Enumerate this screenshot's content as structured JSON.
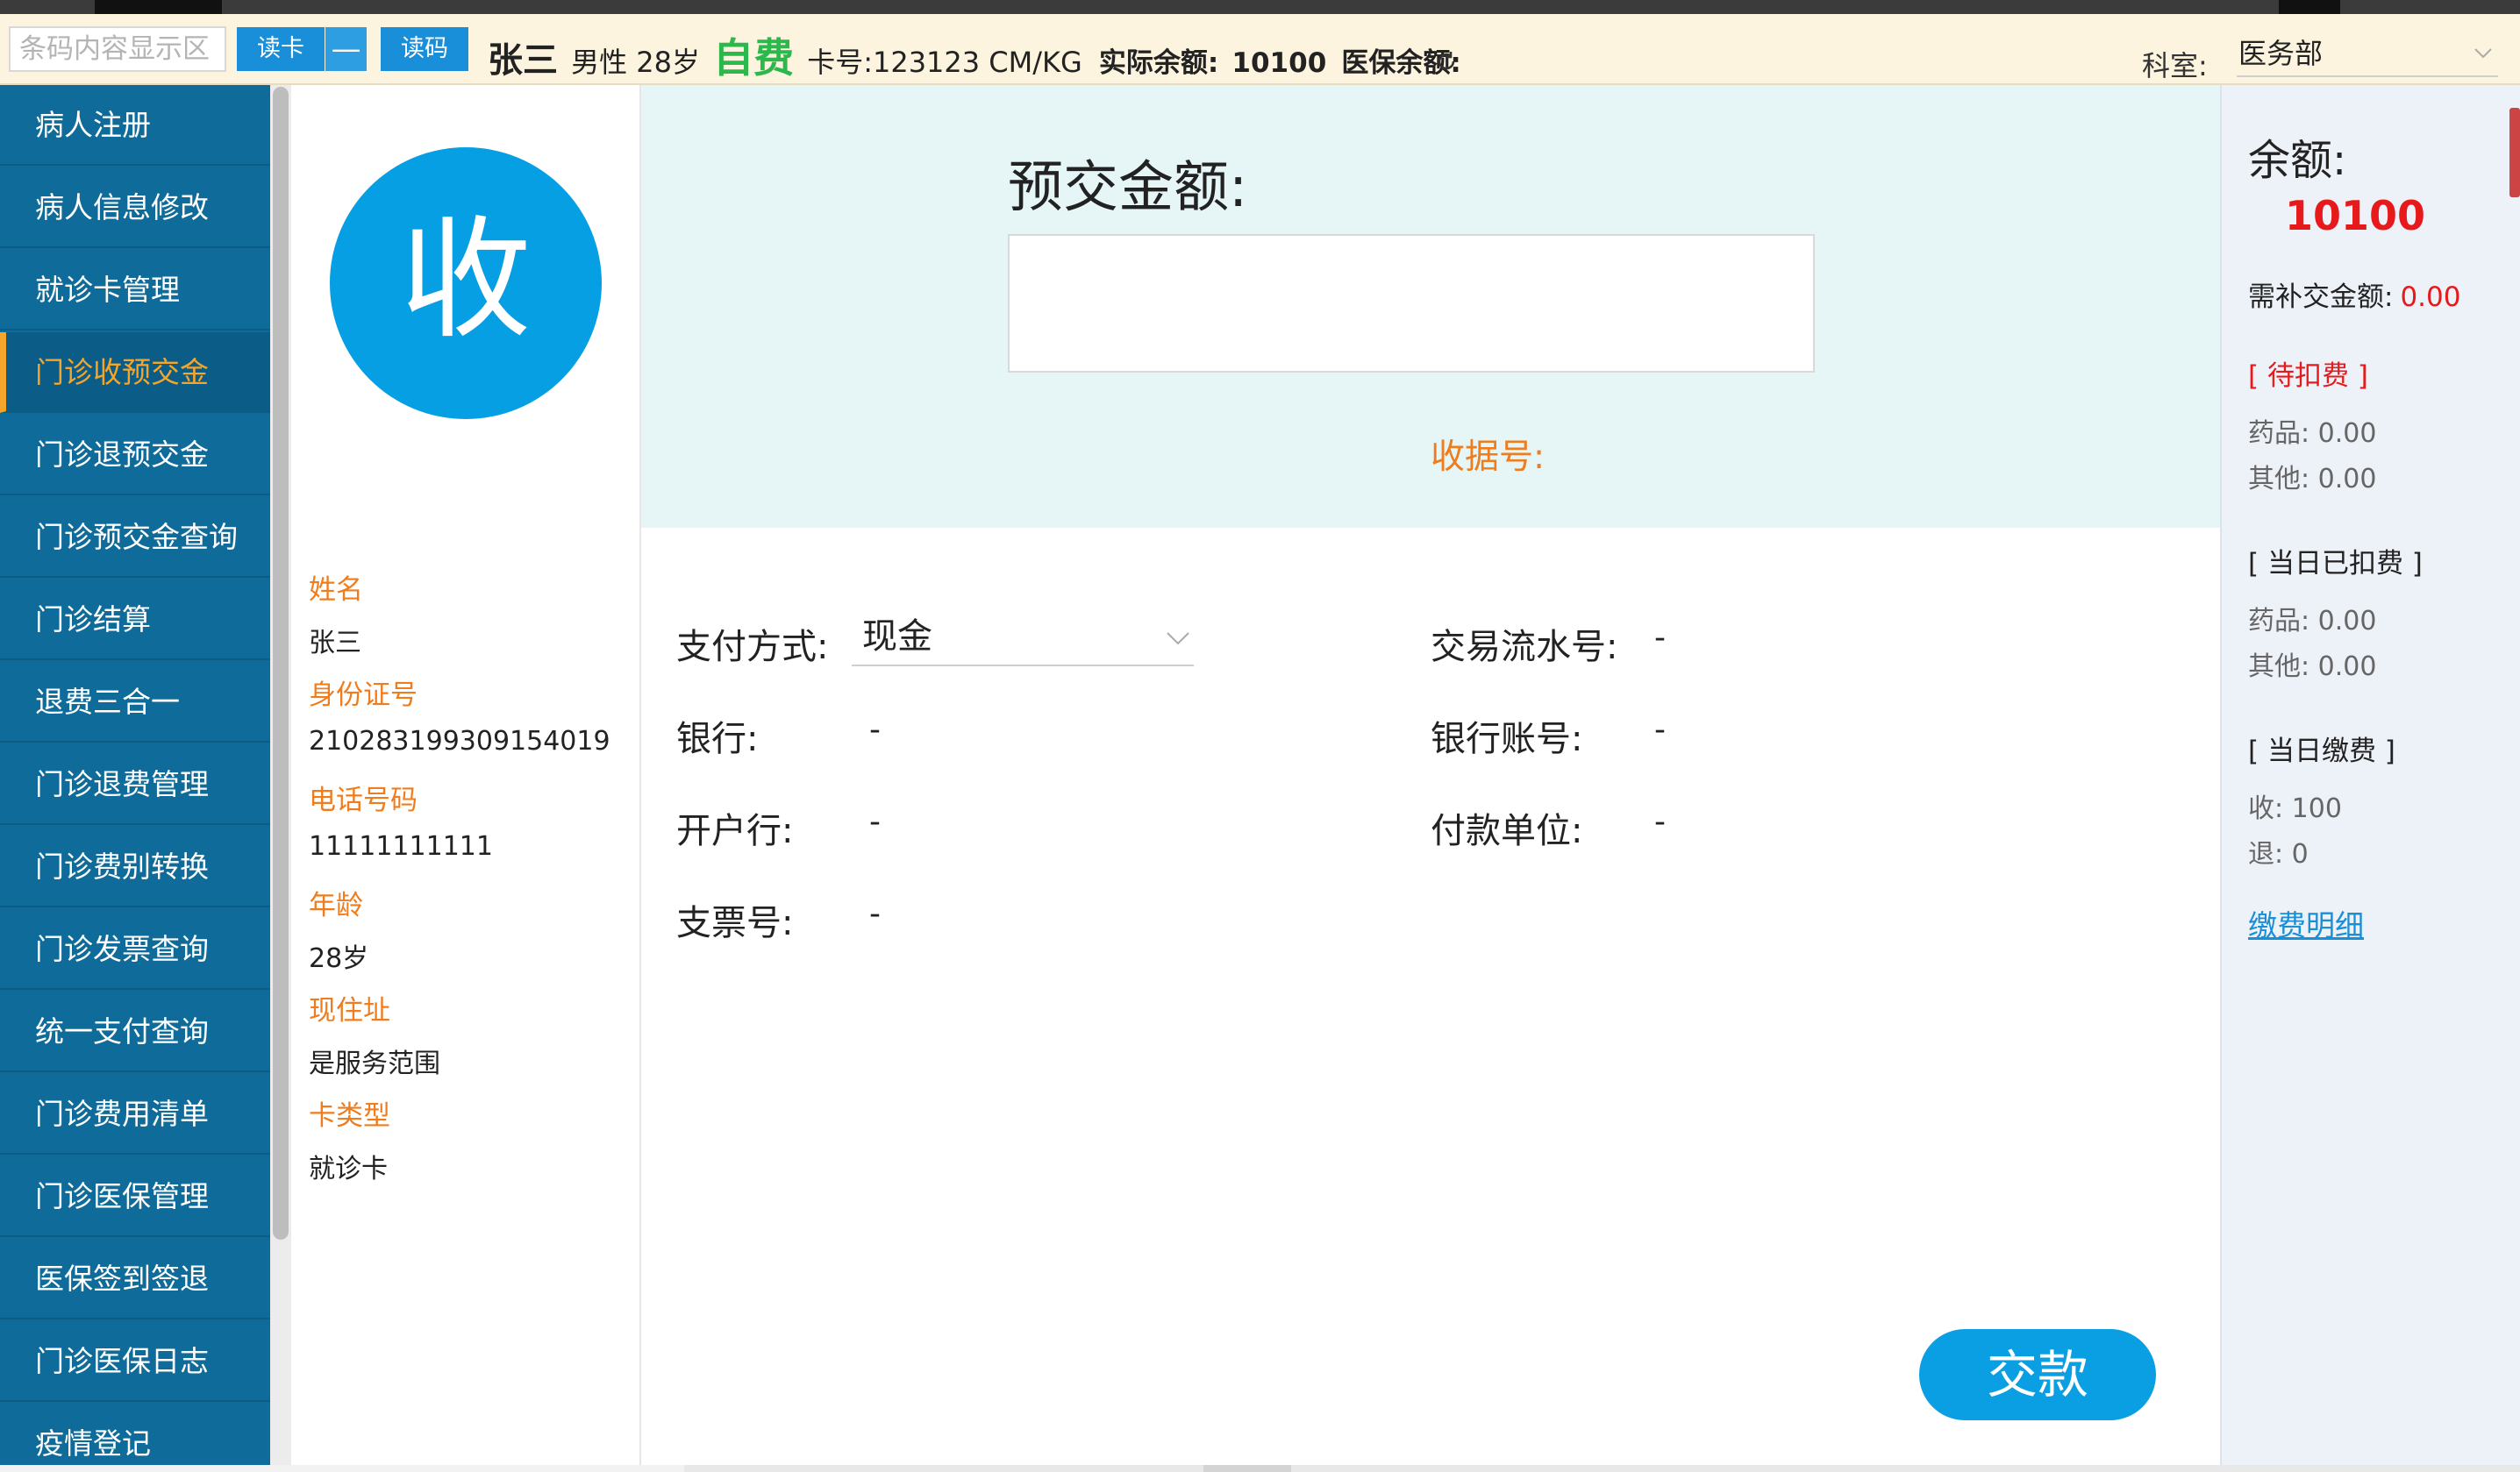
{
  "header": {
    "barcode_placeholder": "条码内容显示区",
    "read_card_label": "读卡",
    "minus_label": "—",
    "read_code_label": "读码",
    "patient_name": "张三",
    "gender_age": "男性 28岁",
    "fee_type": "自费",
    "card_no_text": "卡号:123123 CM/KG",
    "actual_balance_label": "实际余额:",
    "actual_balance_value": "10100",
    "insurance_balance_label": "医保余额:",
    "department_label": "科室:",
    "department_value": "医务部"
  },
  "sidebar": {
    "active_index": 3,
    "items": [
      {
        "label": "病人注册"
      },
      {
        "label": "病人信息修改"
      },
      {
        "label": "就诊卡管理"
      },
      {
        "label": "门诊收预交金"
      },
      {
        "label": "门诊退预交金"
      },
      {
        "label": "门诊预交金查询"
      },
      {
        "label": "门诊结算"
      },
      {
        "label": "退费三合一"
      },
      {
        "label": "门诊退费管理"
      },
      {
        "label": "门诊费别转换"
      },
      {
        "label": "门诊发票查询"
      },
      {
        "label": "统一支付查询"
      },
      {
        "label": "门诊费用清单"
      },
      {
        "label": "门诊医保管理"
      },
      {
        "label": "医保签到签退"
      },
      {
        "label": "门诊医保日志"
      },
      {
        "label": "疫情登记"
      }
    ]
  },
  "patient": {
    "avatar_char": "收",
    "name_label": "姓名",
    "name_value": "张三",
    "id_label": "身份证号",
    "id_value": "210283199309154019",
    "phone_label": "电话号码",
    "phone_value": "11111111111",
    "age_label": "年龄",
    "age_value": "28岁",
    "address_label": "现住址",
    "address_value": "是服务范围",
    "card_type_label": "卡类型",
    "card_type_value": "就诊卡"
  },
  "form": {
    "prepay_title": "预交金额:",
    "prepay_value": "",
    "receipt_label": "收据号:",
    "pay_method_label": "支付方式:",
    "pay_method_value": "现金",
    "serial_label": "交易流水号:",
    "serial_value": "-",
    "bank_label": "银行:",
    "bank_value": "-",
    "bank_account_label": "银行账号:",
    "bank_account_value": "-",
    "open_bank_label": "开户行:",
    "open_bank_value": "-",
    "payer_unit_label": "付款单位:",
    "payer_unit_value": "-",
    "cheque_label": "支票号:",
    "cheque_value": "-",
    "submit_label": "交款"
  },
  "summary": {
    "balance_title": "余额:",
    "balance_value": "10100",
    "supplement_label": "需补交金额:",
    "supplement_value": "0.00",
    "pending_title": "[ 待扣费 ]",
    "pending_drug": "药品: 0.00",
    "pending_other": "其他: 0.00",
    "deducted_title": "[ 当日已扣费 ]",
    "deducted_drug": "药品: 0.00",
    "deducted_other": "其他: 0.00",
    "paid_title": "[ 当日缴费 ]",
    "paid_in": "收: 100",
    "paid_out": "退: 0",
    "detail_link": "缴费明细"
  },
  "colors": {
    "sidebar_bg": "#0f6b99",
    "active_nav": "#f4a52a",
    "accent_blue": "#0a9fe3",
    "label_orange": "#ef7d1e",
    "alert_red": "#e61a1a",
    "self_pay_green": "#2db84e"
  }
}
